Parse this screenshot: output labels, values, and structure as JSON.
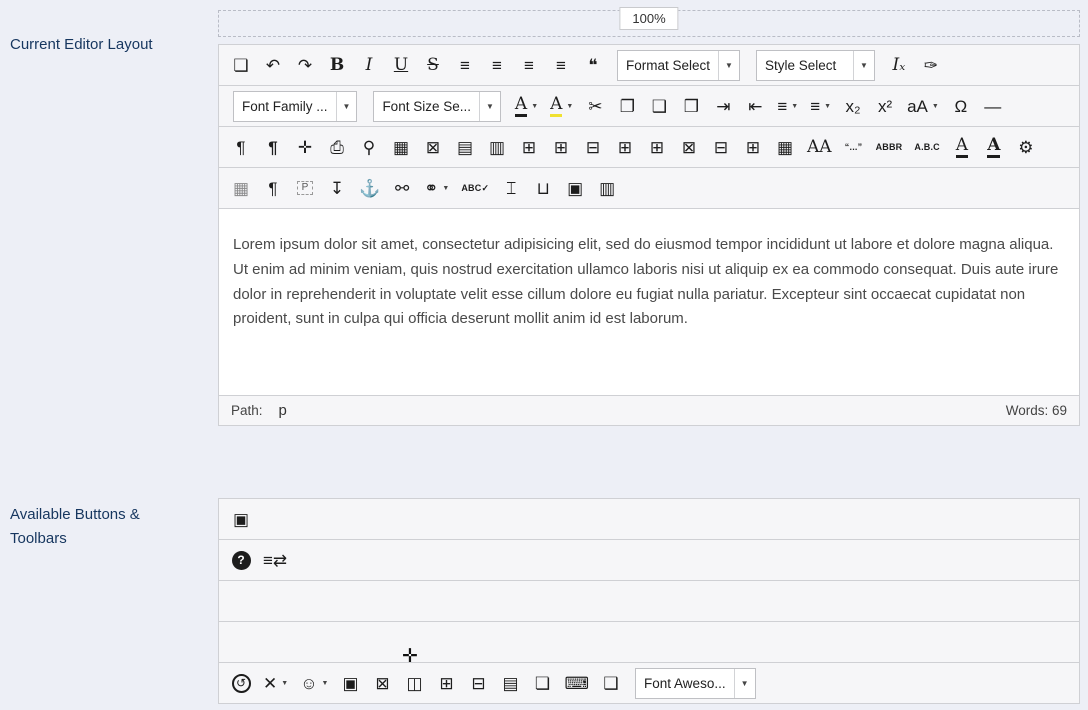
{
  "colors": {
    "page_bg": "#edeff6",
    "label_text": "#16365f",
    "toolbar_bg": "#f6f6f8",
    "border": "#cfd0d4",
    "highlight_yellow": "#f0e130"
  },
  "ui": {
    "zoom_label": "100%",
    "caret_glyph": "▼",
    "move_cursor_glyph": "✛"
  },
  "labels": {
    "current_layout": "Current Editor Layout",
    "available": "Available Buttons & Toolbars"
  },
  "editor": {
    "toolbars": [
      {
        "buttons": [
          {
            "name": "new-document",
            "glyph": "❏"
          },
          {
            "name": "undo",
            "glyph": "↶"
          },
          {
            "name": "redo",
            "glyph": "↷"
          },
          {
            "name": "bold",
            "glyph": "B",
            "cls": "bold serif"
          },
          {
            "name": "italic",
            "glyph": "I",
            "cls": "italic serif"
          },
          {
            "name": "underline",
            "glyph": "U",
            "cls": "underline serif"
          },
          {
            "name": "strikethrough",
            "glyph": "S",
            "cls": "strike serif"
          },
          {
            "name": "justify-full",
            "glyph": "≡"
          },
          {
            "name": "justify-center",
            "glyph": "≡"
          },
          {
            "name": "justify-left",
            "glyph": "≡"
          },
          {
            "name": "justify-right",
            "glyph": "≡"
          },
          {
            "name": "blockquote",
            "glyph": "❝"
          },
          {
            "name": "format-select",
            "type": "select",
            "label": "Format Select"
          },
          {
            "name": "style-select",
            "type": "select",
            "label": "Style Select"
          },
          {
            "name": "remove-format",
            "glyph": "Iₓ",
            "cls": "italic serif"
          },
          {
            "name": "cleanup",
            "glyph": "✑"
          }
        ]
      },
      {
        "buttons": [
          {
            "name": "font-family-select",
            "type": "select",
            "label": "Font Family ..."
          },
          {
            "name": "font-size-select",
            "type": "select",
            "label": "Font Size Se..."
          },
          {
            "name": "text-color",
            "glyph": "A",
            "cls": "serif ul-dark",
            "caret": true
          },
          {
            "name": "highlight-color",
            "glyph": "A",
            "cls": "serif ul-yellow",
            "caret": true
          },
          {
            "name": "cut",
            "glyph": "✂"
          },
          {
            "name": "copy",
            "glyph": "❐"
          },
          {
            "name": "paste",
            "glyph": "❑"
          },
          {
            "name": "paste-as-text",
            "glyph": "❒"
          },
          {
            "name": "indent",
            "glyph": "⇥"
          },
          {
            "name": "outdent",
            "glyph": "⇤"
          },
          {
            "name": "numbered-list",
            "glyph": "≡",
            "caret": true
          },
          {
            "name": "bullet-list",
            "glyph": "≡",
            "caret": true
          },
          {
            "name": "subscript",
            "glyph": "x₂"
          },
          {
            "name": "superscript",
            "glyph": "x²"
          },
          {
            "name": "case-change",
            "glyph": "aA",
            "caret": true
          },
          {
            "name": "special-character",
            "glyph": "Ω"
          },
          {
            "name": "horizontal-rule",
            "glyph": "—"
          }
        ]
      },
      {
        "buttons": [
          {
            "name": "visual-chars",
            "glyph": "¶"
          },
          {
            "name": "paragraph-mark",
            "glyph": "¶",
            "cls": "bold"
          },
          {
            "name": "fullscreen",
            "glyph": "✛"
          },
          {
            "name": "print",
            "glyph": "⎙"
          },
          {
            "name": "search-replace",
            "glyph": "⚲"
          },
          {
            "name": "insert-table",
            "glyph": "▦"
          },
          {
            "name": "delete-table",
            "glyph": "⊠"
          },
          {
            "name": "table-row-properties",
            "glyph": "▤"
          },
          {
            "name": "table-cell-properties",
            "glyph": "▥"
          },
          {
            "name": "insert-row-before",
            "glyph": "⊞"
          },
          {
            "name": "insert-row-after",
            "glyph": "⊞"
          },
          {
            "name": "delete-row",
            "glyph": "⊟"
          },
          {
            "name": "insert-column-before",
            "glyph": "⊞"
          },
          {
            "name": "insert-column-after",
            "glyph": "⊞"
          },
          {
            "name": "delete-column",
            "glyph": "⊠"
          },
          {
            "name": "split-cells",
            "glyph": "⊟"
          },
          {
            "name": "merge-cells",
            "glyph": "⊞"
          },
          {
            "name": "table-properties",
            "glyph": "▦"
          },
          {
            "name": "font-scale",
            "glyph": "AA",
            "cls": "serif"
          },
          {
            "name": "quote",
            "glyph": "“...”",
            "cls": "tiny"
          },
          {
            "name": "abbreviation",
            "glyph": "ABBR",
            "cls": "tiny"
          },
          {
            "name": "acronym",
            "glyph": "A.B.C",
            "cls": "tiny"
          },
          {
            "name": "inserted-text",
            "glyph": "A",
            "cls": "serif ul-dark"
          },
          {
            "name": "deleted-text",
            "glyph": "A",
            "cls": "serif bold ul-dark"
          },
          {
            "name": "preferences",
            "glyph": "⚙"
          }
        ]
      },
      {
        "buttons": [
          {
            "name": "visual-aid",
            "glyph": "▦",
            "cls": "dotted"
          },
          {
            "name": "paragraph",
            "glyph": "¶"
          },
          {
            "name": "visual-blocks",
            "glyph": "P",
            "cls": "dashed-box"
          },
          {
            "name": "insert-template",
            "glyph": "↧"
          },
          {
            "name": "anchor",
            "glyph": "⚓"
          },
          {
            "name": "unlink",
            "glyph": "⚯"
          },
          {
            "name": "link",
            "glyph": "⚭",
            "caret": true
          },
          {
            "name": "spellcheck",
            "glyph": "ABC✓",
            "cls": "tiny"
          },
          {
            "name": "page-break",
            "glyph": "⌶"
          },
          {
            "name": "nonbreaking-space",
            "glyph": "⊔"
          },
          {
            "name": "insert-image",
            "glyph": "▣"
          },
          {
            "name": "insert-media",
            "glyph": "▥"
          }
        ]
      }
    ],
    "content": {
      "text": "Lorem ipsum dolor sit amet, consectetur adipisicing elit, sed do eiusmod tempor incididunt ut labore et dolore magna aliqua. Ut enim ad minim veniam, quis nostrud exercitation ullamco laboris nisi ut aliquip ex ea commodo consequat. Duis aute irure dolor in reprehenderit in voluptate velit esse cillum dolore eu fugiat nulla pariatur. Excepteur sint occaecat cupidatat non proident, sunt in culpa qui officia deserunt mollit anim id est laborum."
    },
    "statusbar": {
      "path_label": "Path:",
      "path_value": "p",
      "words": "Words: 69"
    }
  },
  "available": {
    "rows": [
      {
        "buttons": [
          {
            "name": "image",
            "glyph": "▣"
          }
        ]
      },
      {
        "buttons": [
          {
            "name": "help",
            "glyph": "?",
            "cls": "circle-dark"
          },
          {
            "name": "toggle-toolbar",
            "glyph": "≡⇄"
          }
        ]
      },
      {
        "buttons": []
      },
      {
        "buttons": []
      },
      {
        "buttons": [
          {
            "name": "history",
            "glyph": "↺",
            "cls": "circled"
          },
          {
            "name": "joomla-links",
            "glyph": "✕",
            "caret": true
          },
          {
            "name": "emoticons",
            "glyph": "☺",
            "caret": true
          },
          {
            "name": "image-manager",
            "glyph": "▣"
          },
          {
            "name": "media-manager",
            "glyph": "⊠"
          },
          {
            "name": "columns",
            "glyph": "◫"
          },
          {
            "name": "insert-layout",
            "glyph": "⊞"
          },
          {
            "name": "tabs",
            "glyph": "⊟"
          },
          {
            "name": "article-break",
            "glyph": "▤"
          },
          {
            "name": "readmore",
            "glyph": "❏"
          },
          {
            "name": "keyboard",
            "glyph": "⌨"
          },
          {
            "name": "mediabox",
            "glyph": "❑"
          },
          {
            "name": "fontawesome-select",
            "type": "select",
            "label": "Font Aweso..."
          }
        ]
      }
    ]
  }
}
